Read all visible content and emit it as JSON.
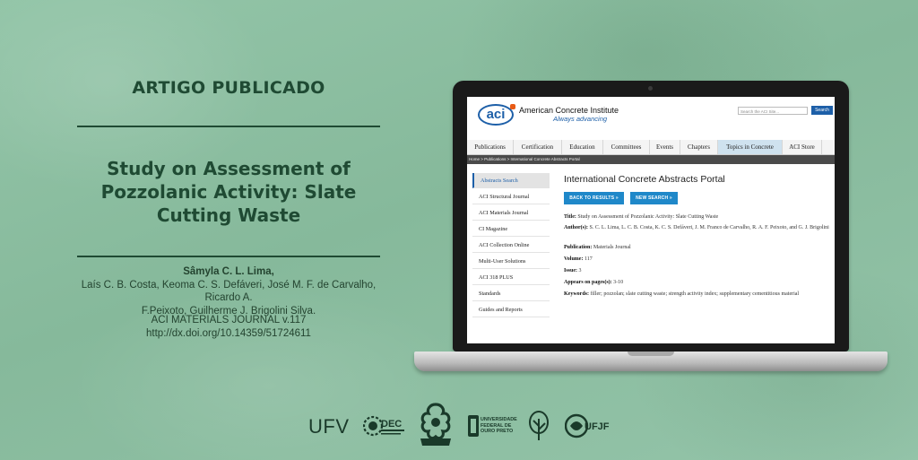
{
  "poster": {
    "kicker": "ARTIGO PUBLICADO",
    "title": "Study on Assessment of Pozzolanic Activity: Slate Cutting Waste",
    "authors_main": "Sâmyla C. L. Lima,",
    "authors_rest_1": "Laís C. B. Costa, Keoma C. S. Defáveri, José M. F. de Carvalho, Ricardo A.",
    "authors_rest_2": "F.Peixoto, Guilherme J. Brigolini Silva.",
    "journal": "ACI MATERIALS JOURNAL v.117",
    "doi": "http://dx.doi.org/10.14359/51724611"
  },
  "site": {
    "logo_text": "aci",
    "org_name": "American Concrete Institute",
    "tagline": "Always advancing",
    "search_placeholder": "Search the ACI Site...",
    "search_button": "Search",
    "nav": [
      "Publications",
      "Certification",
      "Education",
      "Committees",
      "Events",
      "Chapters",
      "Topics in Concrete",
      "ACI Store"
    ],
    "breadcrumb": "Home > Publications > International Concrete Abstracts Portal",
    "sidebar": [
      "Abstracts Search",
      "ACI Structural Journal",
      "ACI Materials Journal",
      "CI Magazine",
      "ACI Collection Online",
      "Multi-User Solutions",
      "ACI 318 PLUS",
      "Standards",
      "Guides and Reports"
    ],
    "portal_title": "International Concrete Abstracts Portal",
    "back_button": "BACK TO RESULTS »",
    "new_search_button": "NEW SEARCH »",
    "fields": [
      {
        "label": "Title:",
        "value": "Study on Assessment of Pozzolanic Activity: Slate Cutting Waste"
      },
      {
        "label": "Author(s):",
        "value": "S. C. L. Lima, L. C. B. Costa, K. C. S. Defáveri, J. M. Franco de Carvalho, R. A. F. Peixoto, and G. J. Brigolini"
      },
      {
        "label": "Publication:",
        "value": "Materials Journal"
      },
      {
        "label": "Volume:",
        "value": "117"
      },
      {
        "label": "Issue:",
        "value": "3"
      },
      {
        "label": "Appears on pages(s):",
        "value": "3-10"
      },
      {
        "label": "Keywords:",
        "value": "filler; pozzolan; slate cutting waste; strength activity index; supplementary cementitious material"
      }
    ]
  },
  "footer_logos": {
    "ufv": "UFV",
    "dec": "DEC",
    "ufop_line1": "UNIVERSIDADE",
    "ufop_line2": "FEDERAL DE",
    "ufop_line3": "OURO PRETO",
    "ufjf": "UFJF"
  }
}
